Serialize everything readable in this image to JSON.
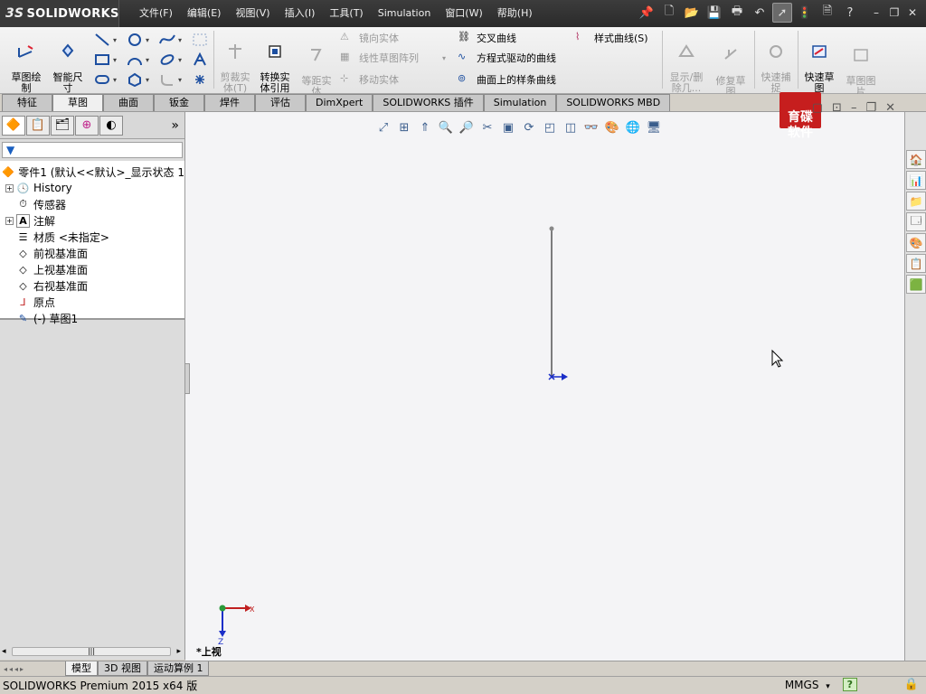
{
  "app": {
    "logo_text": "SOLIDWORKS",
    "logo_mark": "3S"
  },
  "menus": [
    "文件(F)",
    "编辑(E)",
    "视图(V)",
    "插入(I)",
    "工具(T)",
    "Simulation",
    "窗口(W)",
    "帮助(H)"
  ],
  "quick_icons": {
    "pin": "📌",
    "new": "🗋",
    "open": "📂",
    "save": "💾",
    "print": "🖶",
    "undo": "↶",
    "select": "➚",
    "rebuild": "🚦",
    "options": "🗎",
    "help": "?",
    "minimize": "–",
    "restore": "❐",
    "close": "✕"
  },
  "ribbon": {
    "sketch": "草图绘\n制",
    "smart_dim": "智能尺\n寸",
    "trim": "剪裁实\n体(T)",
    "convert": "转换实\n体引用",
    "offset": "等距实\n体",
    "mirror": "镜向实体",
    "linear_pattern": "线性草图阵列",
    "move": "移动实体",
    "intersect": "交叉曲线",
    "equation_curve": "方程式驱动的曲线",
    "face_spline": "曲面上的样条曲线",
    "style_spline": "样式曲线(S)",
    "show_delete": "显示/删\n除几...",
    "repair": "修复草\n图",
    "quick_snap": "快速捕\n捉",
    "rapid_sketch": "快速草\n图",
    "sketch_picture": "草图图\n片"
  },
  "tabs": [
    "特征",
    "草图",
    "曲面",
    "钣金",
    "焊件",
    "评估",
    "DimXpert",
    "SOLIDWORKS 插件",
    "Simulation",
    "SOLIDWORKS MBD"
  ],
  "active_tab_index": 1,
  "feature_tree": {
    "more": "»",
    "filter_icon": "▼",
    "root": "零件1  (默认<<默认>_显示状态 1",
    "items": [
      {
        "label": "History",
        "expandable": true
      },
      {
        "label": "传感器",
        "expandable": false
      },
      {
        "label": "注解",
        "expandable": true
      },
      {
        "label": "材质 <未指定>",
        "expandable": false
      },
      {
        "label": "前视基准面",
        "expandable": false
      },
      {
        "label": "上视基准面",
        "expandable": false
      },
      {
        "label": "右视基准面",
        "expandable": false
      },
      {
        "label": "原点",
        "expandable": false
      },
      {
        "label": "(-) 草图1",
        "expandable": false
      }
    ]
  },
  "graphics": {
    "view_name": "*上视",
    "watermark": "育碟\n软件",
    "triad_x": "X",
    "triad_z": "Z"
  },
  "bottom_tabs": [
    "模型",
    "3D 视图",
    "运动算例 1"
  ],
  "active_bottom_tab": 0,
  "status": {
    "text": "SOLIDWORKS Premium 2015 x64 版",
    "units": "MMGS",
    "units_caret": "▾",
    "help": "?"
  }
}
